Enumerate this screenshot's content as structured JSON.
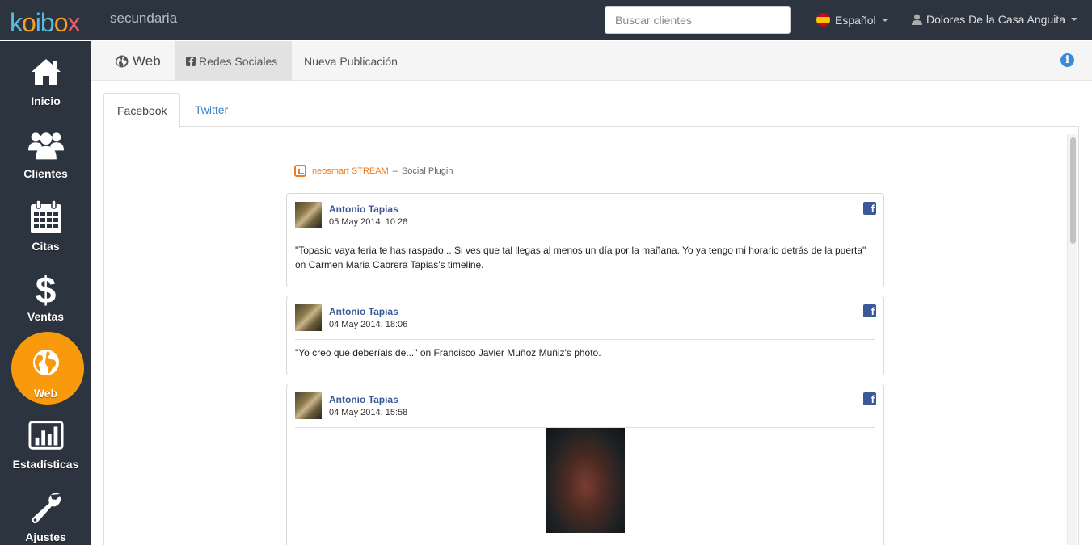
{
  "app": {
    "logo": "koibox",
    "shop_name": "secundaria"
  },
  "header": {
    "search_placeholder": "Buscar clientes",
    "language": "Español",
    "user": "Dolores De la Casa Anguita"
  },
  "sidebar": {
    "items": [
      {
        "label": "Inicio",
        "icon": "home-icon"
      },
      {
        "label": "Clientes",
        "icon": "users-icon"
      },
      {
        "label": "Citas",
        "icon": "calendar-icon"
      },
      {
        "label": "Ventas",
        "icon": "dollar-icon"
      },
      {
        "label": "Web",
        "icon": "globe-icon",
        "active": true
      },
      {
        "label": "Estadísticas",
        "icon": "bar-chart-icon"
      },
      {
        "label": "Ajustes",
        "icon": "wrench-icon"
      }
    ]
  },
  "subheader": {
    "section": "Web",
    "tabs": [
      {
        "label": "Redes Sociales",
        "active": true
      },
      {
        "label": "Nueva Publicación"
      }
    ],
    "info": "i"
  },
  "tabs": [
    {
      "label": "Facebook",
      "active": true
    },
    {
      "label": "Twitter"
    }
  ],
  "plugin": {
    "brand": "neosmart STREAM",
    "separator": "–",
    "subtitle": "Social Plugin"
  },
  "posts": [
    {
      "author": "Antonio Tapias",
      "date": "05 May 2014, 10:28",
      "text": "\"Topasio vaya feria te has raspado... Si ves que tal llegas al menos un día por la mañana. Yo ya tengo mi horario detrás de la puerta\" on Carmen Maria Cabrera Tapias's timeline."
    },
    {
      "author": "Antonio Tapias",
      "date": "04 May 2014, 18:06",
      "text": "\"Yo creo que deberíais de...\" on Francisco Javier Muñoz Muñiz's photo."
    },
    {
      "author": "Antonio Tapias",
      "date": "04 May 2014, 15:58",
      "text": ""
    }
  ],
  "colors": {
    "topbar": "#2c3440",
    "accent": "#f99a0c",
    "facebook": "#3b5998",
    "link": "#3b7fc4"
  }
}
